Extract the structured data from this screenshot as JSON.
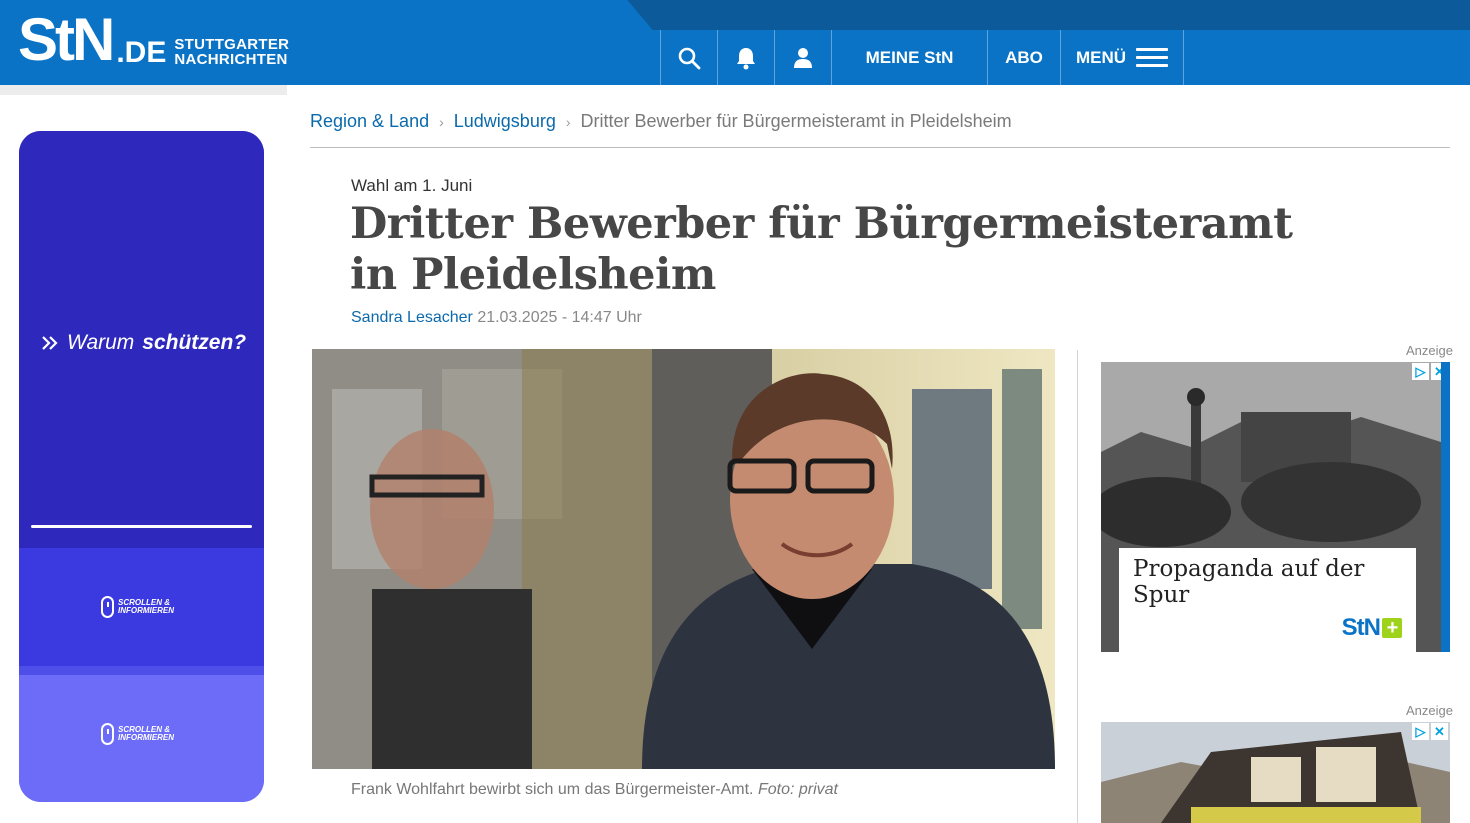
{
  "header": {
    "logo_main": "StN",
    "logo_tld": ".DE",
    "logo_line1": "STUTTGARTER",
    "logo_line2": "NACHRICHTEN",
    "nav": {
      "meine": "MEINE StN",
      "abo": "ABO",
      "menu": "MENÜ"
    },
    "icons": [
      "search-icon",
      "bell-icon",
      "user-icon",
      "hamburger-icon"
    ],
    "colors": {
      "brand_blue": "#0b73c6",
      "dark_blue": "#0d5a9a"
    }
  },
  "left_ad": {
    "cta_prefix": "Warum",
    "cta_bold": "schützen?",
    "scroll_line1": "SCROLLEN &",
    "scroll_line2": "INFORMIEREN",
    "colors": [
      "#2e28bd",
      "#3b39e0",
      "#6c6cf8"
    ]
  },
  "breadcrumb": {
    "items": [
      "Region & Land",
      "Ludwigsburg"
    ],
    "current": "Dritter Bewerber für Bürgermeisteramt in Pleidelsheim"
  },
  "article": {
    "kicker": "Wahl am 1. Juni",
    "headline": "Dritter Bewerber für Bürgermeisteramt in Pleidelsheim",
    "author": "Sandra Lesacher",
    "datetime": "21.03.2025 - 14:47 Uhr",
    "caption": "Frank Wohlfahrt bewirbt sich um das Bürgermeister-Amt.",
    "credit": "Foto: privat"
  },
  "ads": {
    "label": "Anzeige",
    "ad1_title": "Propaganda auf der Spur",
    "ad1_brand": "StN",
    "ad1_plus": "+",
    "adchoices": [
      "▷",
      "✕"
    ]
  }
}
